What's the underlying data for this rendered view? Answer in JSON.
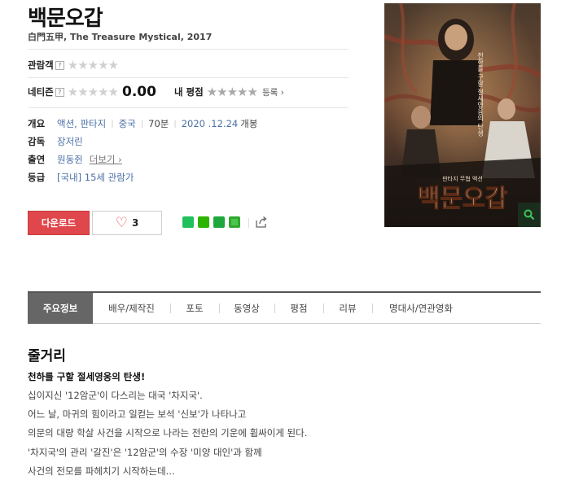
{
  "movie": {
    "title": "백문오갑",
    "subtitle": "白門五甲, The Treasure Mystical, 2017"
  },
  "ratings": {
    "audience_label": "관람객",
    "netizen_label": "네티즌",
    "qmark": "?",
    "audience_stars": "★★★★★",
    "netizen_stars": "★★★★★",
    "netizen_score": "0.00",
    "my_rating_label": "내 평점",
    "my_stars": "★★★★★",
    "register_label": "등록 ›"
  },
  "info": {
    "overview_label": "개요",
    "genre": "액션, 판타지",
    "country": "중국",
    "runtime": "70분",
    "release_date": "2020 .12.24",
    "release_suffix": "개봉",
    "director_label": "감독",
    "director": "장저린",
    "cast_label": "출연",
    "cast": "원동쥔",
    "more_label": "더보기 ›",
    "rating_label": "등급",
    "rating": "[국내] 15세 관람가"
  },
  "actions": {
    "download_label": "다운로드",
    "like_count": "3"
  },
  "poster": {
    "tagline": "천하를 구할 절세영웅의 탄생",
    "small_title": "판타지 무협 액션",
    "title": "백문오갑"
  },
  "tabs": [
    {
      "label": "주요정보"
    },
    {
      "label": "배우/제작진"
    },
    {
      "label": "포토"
    },
    {
      "label": "동영상"
    },
    {
      "label": "평점"
    },
    {
      "label": "리뷰"
    },
    {
      "label": "명대사/연관영화"
    }
  ],
  "synopsis": {
    "section_title": "줄거리",
    "headline": "천하를 구할 절세영웅의 탄생!",
    "lines": [
      "십이지신 '12암군'이 다스리는 대국 '차지국'.",
      "어느 날, 마귀의 힘이라고 일컫는 보석 '신보'가 나타나고",
      "의문의 대량 학살 사건을 시작으로 나라는 전란의 기운에 휩싸이게 된다.",
      "'차지국'의 관리 '갈진'은 '12암군'의 수장 '미양 대인'과 함께",
      "사건의 전모를 파헤치기 시작하는데..."
    ]
  },
  "colors": {
    "accent_red": "#e0474c",
    "link_blue": "#4a6fa5",
    "tab_active": "#666666"
  }
}
